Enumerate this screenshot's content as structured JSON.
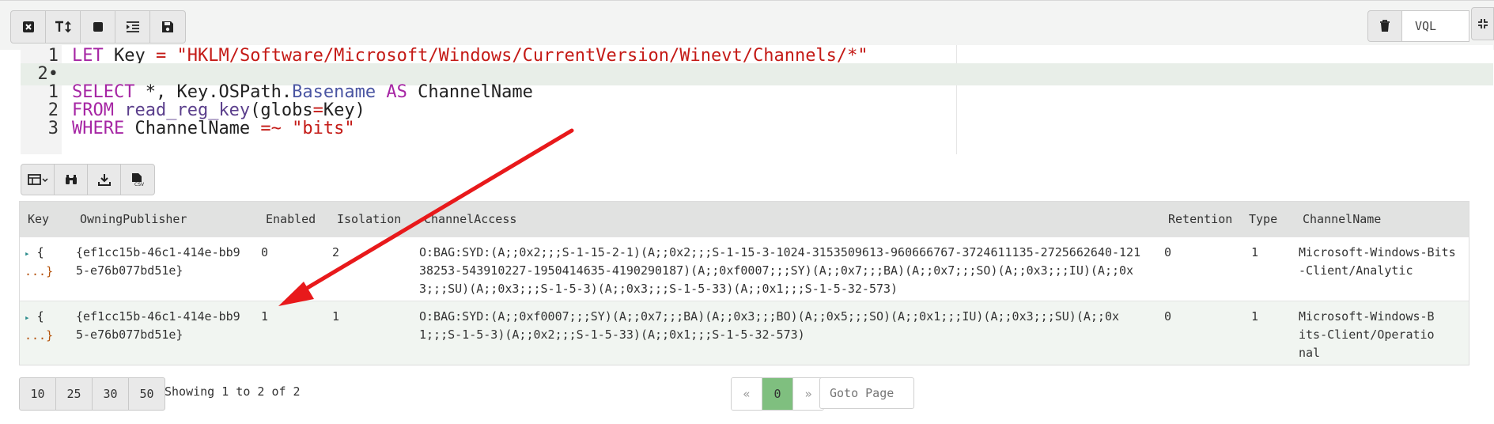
{
  "toolbar": {
    "buttons": [
      "close-icon",
      "text-height-icon",
      "stop-icon",
      "indent-icon",
      "save-icon"
    ],
    "trash_icon": "trash-icon",
    "language_label": "VQL",
    "fullscreen_icon": "compress-icon"
  },
  "editor": {
    "lines": [
      {
        "num": "1",
        "tokens": [
          [
            "kw",
            "LET"
          ],
          [
            "id",
            " Key "
          ],
          [
            "op",
            "="
          ],
          [
            "id",
            " "
          ],
          [
            "str",
            "\"HKLM/Software/Microsoft/Windows/CurrentVersion/Winevt/Channels/*\""
          ]
        ]
      },
      {
        "num": "2•",
        "active": true,
        "tokens": []
      },
      {
        "num": "1",
        "tokens": [
          [
            "kw",
            "SELECT"
          ],
          [
            "id",
            " *, Key.OSPath."
          ],
          [
            "fn",
            "Basename"
          ],
          [
            "id",
            " "
          ],
          [
            "kw",
            "AS"
          ],
          [
            "id",
            " ChannelName"
          ]
        ]
      },
      {
        "num": "2",
        "tokens": [
          [
            "kw",
            "FROM"
          ],
          [
            "id",
            " "
          ],
          [
            "fx",
            "read_reg_key"
          ],
          [
            "id",
            "(globs"
          ],
          [
            "op",
            "="
          ],
          [
            "id",
            "Key)"
          ]
        ]
      },
      {
        "num": "3",
        "tokens": [
          [
            "kw",
            "WHERE"
          ],
          [
            "id",
            " ChannelName "
          ],
          [
            "op",
            "=~"
          ],
          [
            "id",
            " "
          ],
          [
            "str",
            "\"bits\""
          ]
        ]
      }
    ]
  },
  "table_toolbar": {
    "buttons": [
      "columns-icon",
      "binoculars-icon",
      "download-icon",
      "csv-icon"
    ]
  },
  "table": {
    "columns": [
      "Key",
      "OwningPublisher",
      "Enabled",
      "Isolation",
      "ChannelAccess",
      "Retention",
      "Type",
      "ChannelName"
    ],
    "rows": [
      {
        "key_open": "{",
        "key_close": "...}",
        "OwningPublisher": "{ef1cc15b-46c1-414e-bb95-e76b077bd51e}",
        "Enabled": "0",
        "Isolation": "2",
        "ChannelAccess": "O:BAG:SYD:(A;;0x2;;;S-1-15-2-1)(A;;0x2;;;S-1-15-3-1024-3153509613-960666767-3724611135-2725662640-12138253-543910227-1950414635-4190290187)(A;;0xf0007;;;SY)(A;;0x7;;;BA)(A;;0x7;;;SO)(A;;0x3;;;IU)(A;;0x3;;;SU)(A;;0x3;;;S-1-5-3)(A;;0x3;;;S-1-5-33)(A;;0x1;;;S-1-5-32-573)",
        "Retention": "0",
        "Type": "1",
        "ChannelName": "Microsoft-Windows-Bits-Client/Analytic"
      },
      {
        "key_open": "{",
        "key_close": "...}",
        "OwningPublisher": "{ef1cc15b-46c1-414e-bb95-e76b077bd51e}",
        "Enabled": "1",
        "Isolation": "1",
        "ChannelAccess": "O:BAG:SYD:(A;;0xf0007;;;SY)(A;;0x7;;;BA)(A;;0x3;;;BO)(A;;0x5;;;SO)(A;;0x1;;;IU)(A;;0x3;;;SU)(A;;0x1;;;S-1-5-3)(A;;0x2;;;S-1-5-33)(A;;0x1;;;S-1-5-32-573)",
        "Retention": "0",
        "Type": "1",
        "ChannelName": "Microsoft-Windows-Bits-Client/Operational"
      }
    ]
  },
  "pagination": {
    "page_sizes": [
      "10",
      "25",
      "30",
      "50"
    ],
    "showing": "Showing 1 to 2 of 2",
    "prev": "«",
    "current": "0",
    "next": "»",
    "goto_placeholder": "Goto Page"
  },
  "annotation": {
    "arrow_color": "#e8191b"
  }
}
